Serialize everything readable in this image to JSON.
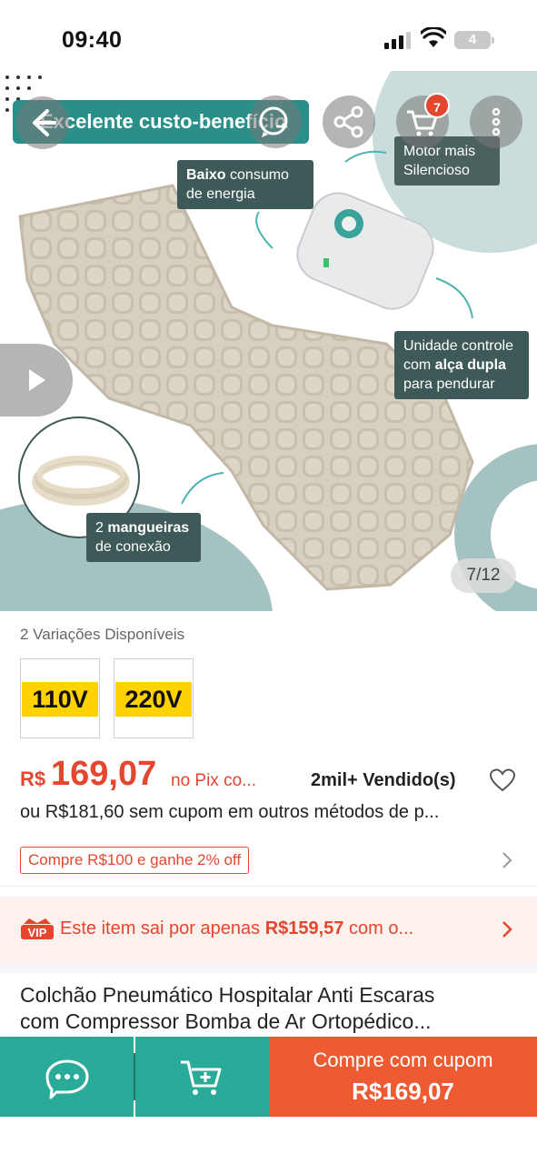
{
  "status_bar": {
    "time": "09:40",
    "battery": "4"
  },
  "hero": {
    "headline": "Excelente custo-benefício",
    "callouts": {
      "baixo_bold": "Baixo",
      "baixo_rest": " consumo de energia",
      "motor": "Motor mais Silencioso",
      "unidade_pre": "Unidade controle com ",
      "unidade_bold": "alça dupla",
      "unidade_post": " para pendurar",
      "mangueira_pre": "2 ",
      "mangueira_bold": "mangueiras",
      "mangueira_post": " de conexão"
    },
    "cart_count": "7",
    "page_indicator": "7/12",
    "icons": [
      "back-arrow-icon",
      "whatsapp-share-icon",
      "share-icon",
      "cart-icon",
      "more-vertical-icon",
      "play-icon"
    ],
    "colors": {
      "teal": "#2a8f88",
      "callout": "#3e5a58",
      "badge": "#e4462e"
    }
  },
  "variations": {
    "label": "2 Variações Disponíveis",
    "options": [
      "110V",
      "220V"
    ]
  },
  "price": {
    "currency": "R$",
    "value": "169,07",
    "pix_label": "no Pix co...",
    "sold": "2mil+ Vendido(s)",
    "alt_price": "ou R$181,60 sem cupom em outros métodos de p..."
  },
  "coupon": {
    "label": "Compre R$100 e ganhe 2% off"
  },
  "vip": {
    "badge": "VIP",
    "text_pre": "Este item sai por apenas ",
    "text_bold": "R$159,57",
    "text_post": " com o..."
  },
  "product": {
    "title_line1": "Colchão Pneumático Hospitalar Anti Escaras",
    "title_line2": "com Compressor Bomba de Ar Ortopédico..."
  },
  "bottom_bar": {
    "buy_label": "Compre com cupom",
    "buy_price": "R$169,07",
    "colors": {
      "chat": "#2aaa98",
      "buy": "#ee5b33"
    }
  }
}
